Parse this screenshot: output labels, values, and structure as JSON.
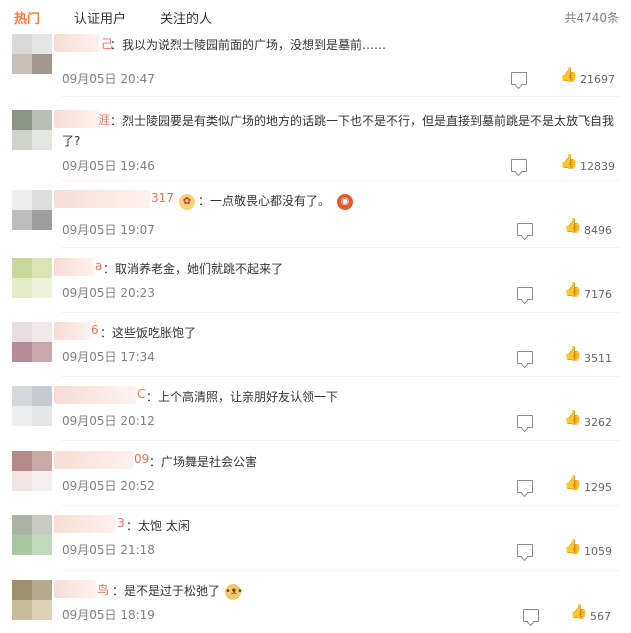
{
  "tabs": [
    {
      "label": "热门"
    },
    {
      "label": "认证用户"
    },
    {
      "label": "关注的人"
    }
  ],
  "total_count": "共4740条",
  "icons": {
    "reply": "comment-icon",
    "like": "thumbs-up-icon"
  },
  "accent_color": "#fa7d3c",
  "comments": [
    {
      "name_tail": "己",
      "text": "：我以为说烈士陵园前面的广场，没想到是墓前……",
      "time": "09月05日 20:47",
      "likes": "21697"
    },
    {
      "name_tail": "涯",
      "text": "：烈士陵园要是有类似广场的地方的话跳一下也不是不行，但是直接到墓前跳是不是太放飞自我",
      "text2": "了?",
      "time": "09月05日 19:46",
      "likes": "12839"
    },
    {
      "name_tail": "317",
      "text": "：一点敬畏心都没有了。",
      "time": "09月05日 19:07",
      "likes": "8496"
    },
    {
      "name_tail": "a",
      "text": "：取消养老金，她们就跳不起来了",
      "time": "09月05日 20:23",
      "likes": "7176"
    },
    {
      "name_tail": "6",
      "text": "：这些饭吃胀饱了",
      "time": "09月05日 17:34",
      "likes": "3511"
    },
    {
      "name_tail": "C",
      "text": "：上个高清照，让亲朋好友认领一下",
      "time": "09月05日 20:12",
      "likes": "3262"
    },
    {
      "name_tail": "09",
      "text": "：广场舞是社会公害",
      "time": "09月05日 20:52",
      "likes": "1295"
    },
    {
      "name_tail": "3",
      "text": "：太饱 太闲",
      "time": "09月05日 21:18",
      "likes": "1059"
    },
    {
      "name_tail": "鸟",
      "text": "：是不是过于松弛了",
      "time": "09月05日 18:19",
      "likes": "567"
    }
  ]
}
